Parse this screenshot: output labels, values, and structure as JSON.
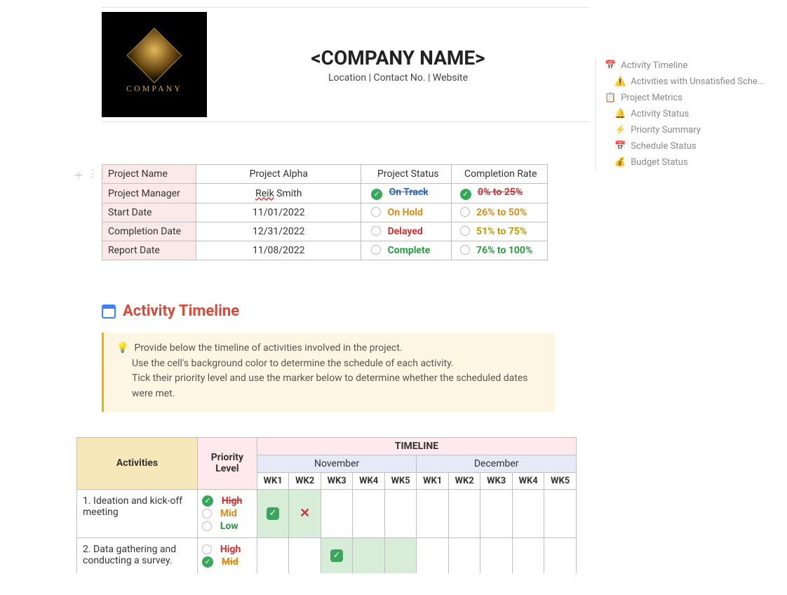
{
  "company": {
    "logo_text": "COMPANY",
    "name": "<COMPANY NAME>",
    "subline": "Location | Contact No. | Website"
  },
  "info_table": {
    "labels": {
      "project_name": "Project Name",
      "project_manager": "Project Manager",
      "start_date": "Start Date",
      "completion_date": "Completion Date",
      "report_date": "Report Date",
      "project_status": "Project Status",
      "completion_rate": "Completion Rate"
    },
    "values": {
      "project_name": "Project Alpha",
      "project_manager_first": "Reik",
      "project_manager_last": "Smith",
      "start_date": "11/01/2022",
      "completion_date": "12/31/2022",
      "report_date": "11/08/2022"
    },
    "statuses": {
      "on_track": "On Track",
      "on_hold": "On Hold",
      "delayed": "Delayed",
      "complete": "Complete"
    },
    "rates": {
      "r0": "0% to 25%",
      "r26": "26% to 50%",
      "r51": "51% to 75%",
      "r76": "76% to 100%"
    }
  },
  "section": {
    "title": "Activity Timeline",
    "tip1": "Provide below the timeline of activities involved in the project.",
    "tip2": "Use the cell's background color to determine the schedule of each activity.",
    "tip3": "Tick their priority level and use the marker below to determine whether the scheduled dates were met."
  },
  "timeline": {
    "headers": {
      "activities": "Activities",
      "priority": "Priority Level",
      "timeline": "TIMELINE",
      "months": [
        "November",
        "December"
      ],
      "weeks": [
        "WK1",
        "WK2",
        "WK3",
        "WK4",
        "WK5",
        "WK1",
        "WK2",
        "WK3",
        "WK4",
        "WK5"
      ]
    },
    "priority_labels": {
      "high": "High",
      "mid": "Mid",
      "low": "Low"
    },
    "rows": [
      {
        "activity": "1. Ideation and kick-off meeting",
        "priority_selected": "high",
        "cells": [
          "tick",
          "x",
          "",
          "",
          "",
          "",
          "",
          "",
          "",
          ""
        ],
        "filled": [
          true,
          true,
          false,
          false,
          false,
          false,
          false,
          false,
          false,
          false
        ]
      },
      {
        "activity": "2. Data gathering and conducting a survey.",
        "priority_selected": "mid",
        "cells": [
          "",
          "",
          "tick",
          "",
          "",
          "",
          "",
          "",
          "",
          ""
        ],
        "filled": [
          false,
          false,
          true,
          true,
          true,
          false,
          false,
          false,
          false,
          false
        ]
      }
    ]
  },
  "nav": {
    "items": [
      {
        "icon": "📅",
        "label": "Activity Timeline",
        "sub": false
      },
      {
        "icon": "⚠️",
        "label": "Activities with Unsatisfied Sche...",
        "sub": true
      },
      {
        "icon": "📋",
        "label": "Project Metrics",
        "sub": false
      },
      {
        "icon": "🔔",
        "label": "Activity Status",
        "sub": true
      },
      {
        "icon": "⚡",
        "label": "Priority Summary",
        "sub": true
      },
      {
        "icon": "📅",
        "label": "Schedule Status",
        "sub": true
      },
      {
        "icon": "💰",
        "label": "Budget Status",
        "sub": true
      }
    ]
  }
}
